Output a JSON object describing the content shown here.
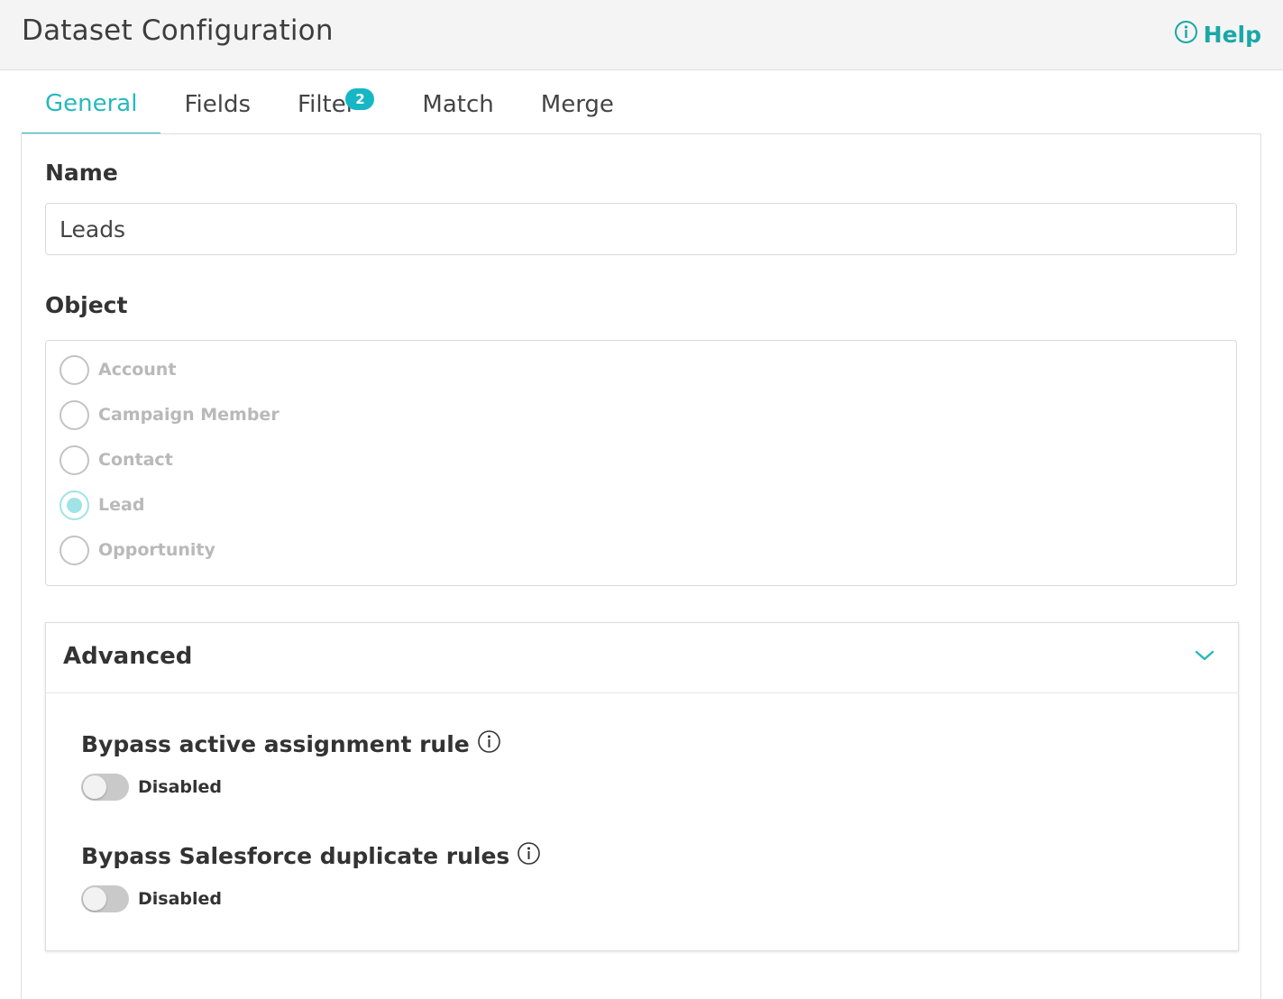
{
  "header": {
    "title": "Dataset Configuration",
    "help_label": "Help"
  },
  "tabs": [
    {
      "label": "General",
      "active": true
    },
    {
      "label": "Fields",
      "active": false
    },
    {
      "label": "Filter",
      "active": false,
      "badge": "2"
    },
    {
      "label": "Match",
      "active": false
    },
    {
      "label": "Merge",
      "active": false
    }
  ],
  "general": {
    "name_label": "Name",
    "name_value": "Leads",
    "object_label": "Object",
    "objects": [
      {
        "label": "Account",
        "selected": false
      },
      {
        "label": "Campaign Member",
        "selected": false
      },
      {
        "label": "Contact",
        "selected": false
      },
      {
        "label": "Lead",
        "selected": true
      },
      {
        "label": "Opportunity",
        "selected": false
      }
    ]
  },
  "advanced": {
    "title": "Advanced",
    "settings": [
      {
        "title": "Bypass active assignment rule",
        "status": "Disabled",
        "enabled": false
      },
      {
        "title": "Bypass Salesforce duplicate rules",
        "status": "Disabled",
        "enabled": false
      }
    ]
  },
  "colors": {
    "accent": "#27b9bb",
    "badge": "#16b6c5",
    "radio_selected": "#9fe3e6"
  },
  "icons": {
    "help": "info-circle-icon",
    "setting_info": "info-circle-icon",
    "expand": "chevron-down-icon"
  }
}
